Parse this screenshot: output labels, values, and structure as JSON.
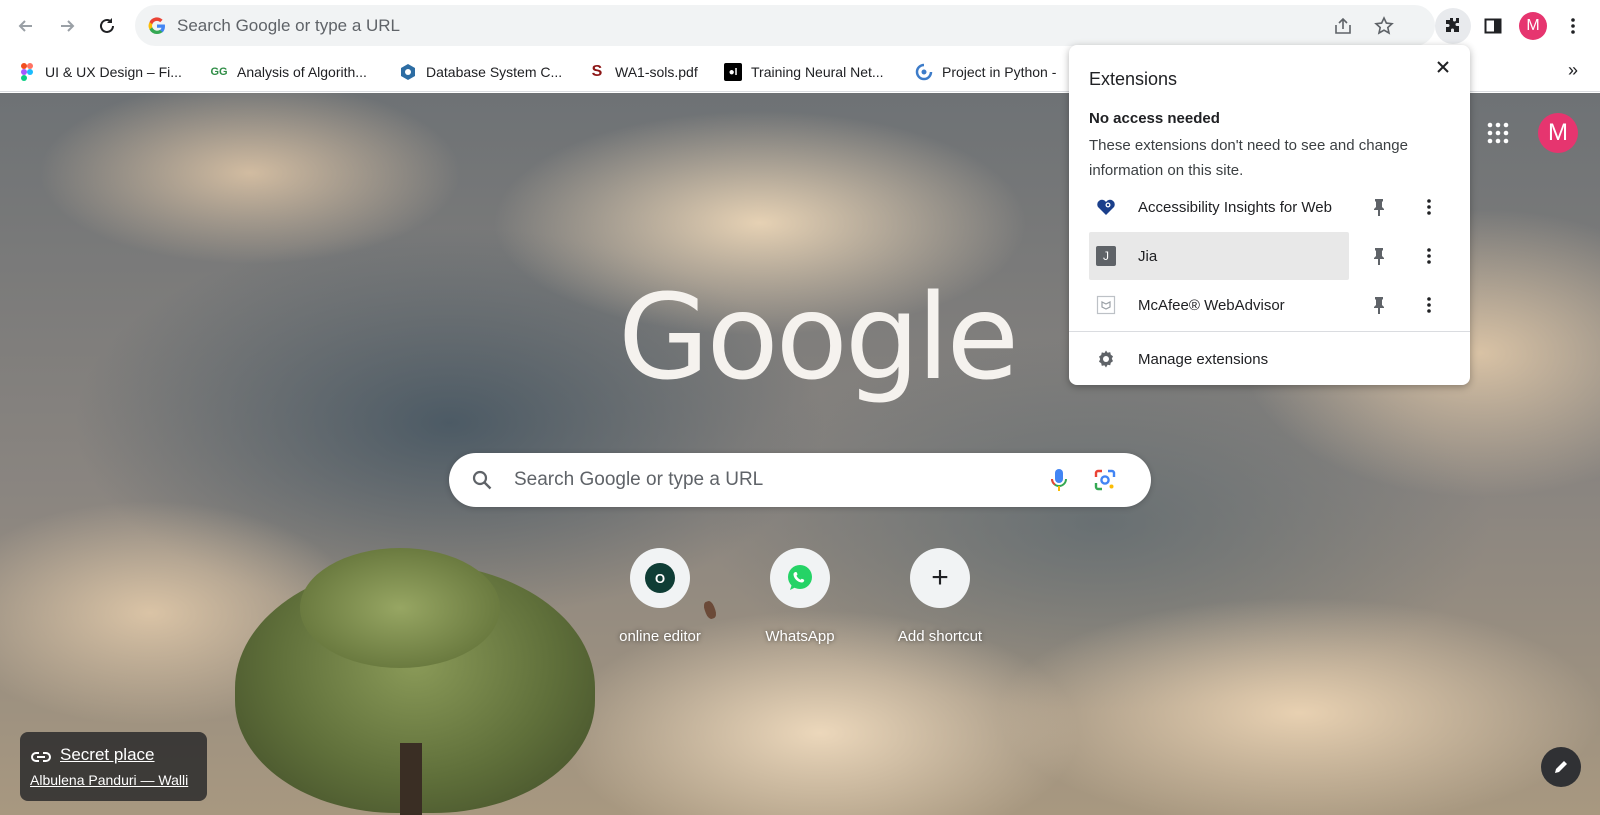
{
  "toolbar": {
    "omnibox_placeholder": "Search Google or type a URL",
    "profile_initial": "M"
  },
  "bookmarks": [
    {
      "label": "UI & UX Design – Fi...",
      "icon": "figma-icon"
    },
    {
      "label": "Analysis of Algorith...",
      "icon": "geeksforgeeks-icon"
    },
    {
      "label": "Database System C...",
      "icon": "database-hexagon-icon"
    },
    {
      "label": "WA1-sols.pdf",
      "icon": "stanford-icon"
    },
    {
      "label": "Training Neural Net...",
      "icon": "medium-icon"
    },
    {
      "label": "Project in Python -",
      "icon": "python-project-icon"
    }
  ],
  "bookmarks_more": "»",
  "ntp": {
    "logo_text": "Google",
    "search_placeholder": "Search Google or type a URL",
    "shortcuts": [
      {
        "label": "online editor",
        "glyph": "O"
      },
      {
        "label": "WhatsApp",
        "glyph": ""
      },
      {
        "label": "Add shortcut",
        "glyph": "+"
      }
    ],
    "profile_initial": "M",
    "attribution": {
      "title": "Secret place",
      "author": "Albulena Panduri — Walli"
    }
  },
  "extensions_popup": {
    "title": "Extensions",
    "section_title": "No access needed",
    "section_desc": "These extensions don't need to see and change information on this site.",
    "items": [
      {
        "name": "Accessibility Insights for Web",
        "icon": "accessibility-heart-icon"
      },
      {
        "name": "Jia",
        "icon": "jia-icon",
        "badge": "J"
      },
      {
        "name": "McAfee® WebAdvisor",
        "icon": "mcafee-icon"
      }
    ],
    "manage_label": "Manage extensions"
  },
  "colors": {
    "profile": "#e6356f",
    "accent_blue": "#1a73e8"
  }
}
